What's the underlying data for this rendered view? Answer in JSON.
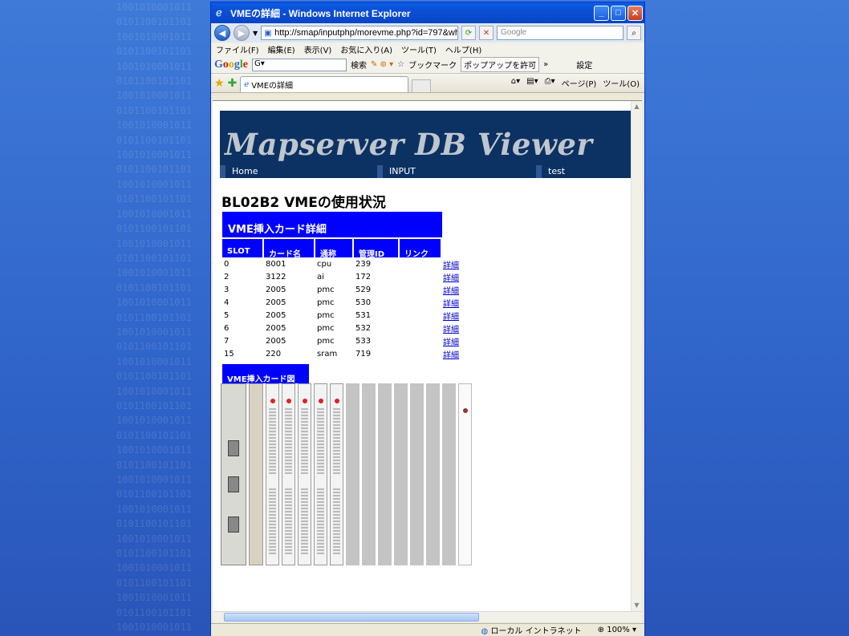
{
  "window": {
    "title": "VMEの詳細 - Windows Internet Explorer",
    "url": "http://smap/inputphp/morevme.php?id=797&wh",
    "search_placeholder": "Google"
  },
  "menu": [
    "ファイル(F)",
    "編集(E)",
    "表示(V)",
    "お気に入り(A)",
    "ツール(T)",
    "ヘルプ(H)"
  ],
  "googlebar": {
    "logo": "Google",
    "search_label": "検索",
    "bookmarks_label": "ブックマーク",
    "popup_label": "ポップアップを許可",
    "settings_label": "設定"
  },
  "tab": {
    "title": "VMEの詳細",
    "page_label": "ページ(P)",
    "tools_label": "ツール(O)"
  },
  "status": {
    "zone": "ローカル イントラネット",
    "zoom": "100%"
  },
  "page": {
    "banner_title": "Mapserver DB Viewer",
    "nav": [
      "Home",
      "INPUT",
      "test"
    ],
    "heading": "BL02B2 VMEの使用状況",
    "card_table": {
      "caption": "VME挿入カード詳細",
      "columns": [
        "SLOT",
        "カード名",
        "通称",
        "管理ID",
        "リンク"
      ],
      "rows": [
        {
          "slot": "0",
          "card": "8001",
          "alias": "cpu",
          "id": "239",
          "link": "詳細"
        },
        {
          "slot": "2",
          "card": "3122",
          "alias": "ai",
          "id": "172",
          "link": "詳細"
        },
        {
          "slot": "3",
          "card": "2005",
          "alias": "pmc",
          "id": "529",
          "link": "詳細"
        },
        {
          "slot": "4",
          "card": "2005",
          "alias": "pmc",
          "id": "530",
          "link": "詳細"
        },
        {
          "slot": "5",
          "card": "2005",
          "alias": "pmc",
          "id": "531",
          "link": "詳細"
        },
        {
          "slot": "6",
          "card": "2005",
          "alias": "pmc",
          "id": "532",
          "link": "詳細"
        },
        {
          "slot": "7",
          "card": "2005",
          "alias": "pmc",
          "id": "533",
          "link": "詳細"
        },
        {
          "slot": "15",
          "card": "220",
          "alias": "sram",
          "id": "719",
          "link": "詳細"
        }
      ]
    },
    "diagram_caption": "VME挿入カード図",
    "rack_slots": [
      "cpu",
      "ai",
      "pmc",
      "pmc",
      "pmc",
      "pmc",
      "pmc",
      "empty",
      "empty",
      "empty",
      "empty",
      "empty",
      "empty",
      "empty",
      "sram"
    ]
  },
  "colors": {
    "banner_bg": "#0c3263",
    "header_blue": "#0000ff",
    "desktop_bg": "#3a6fd2"
  }
}
